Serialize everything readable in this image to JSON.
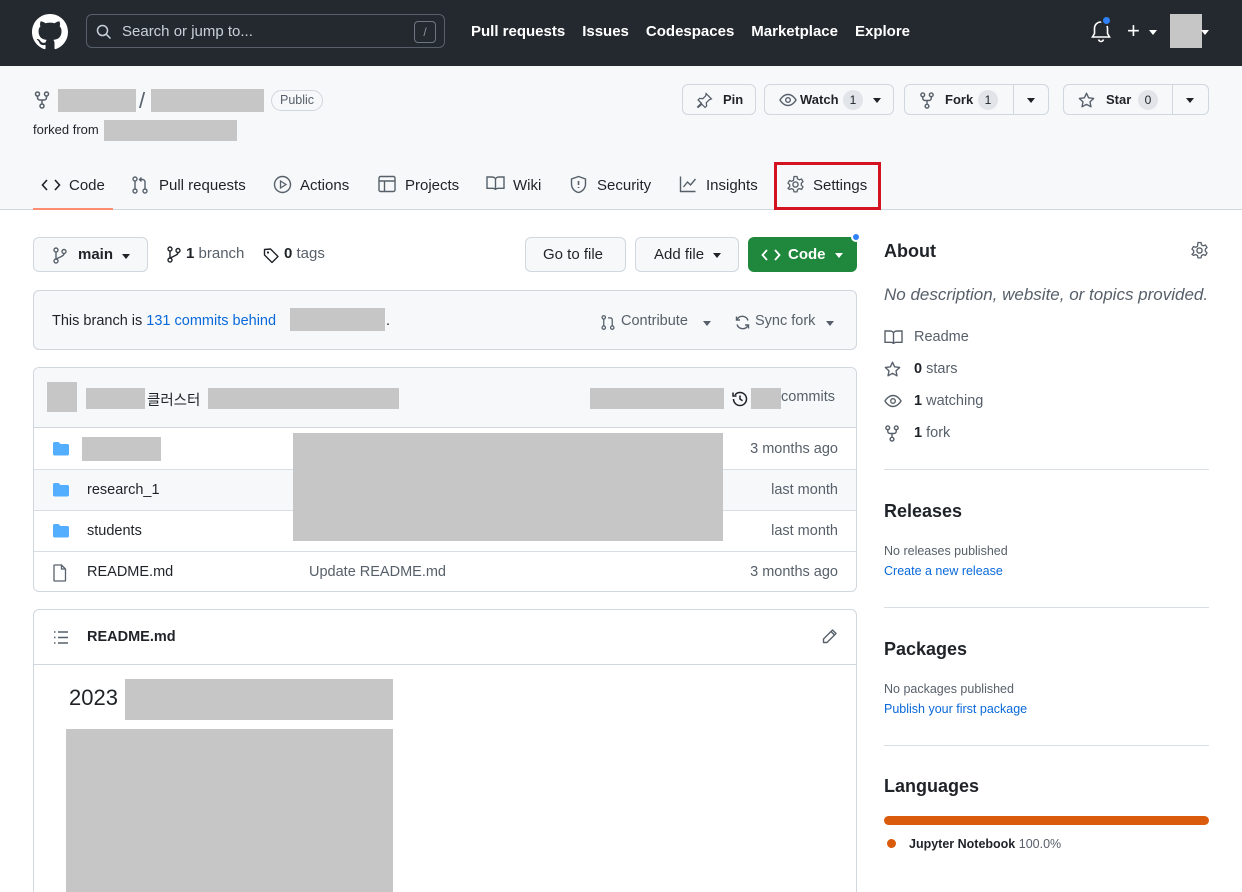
{
  "header": {
    "search_placeholder": "Search or jump to...",
    "search_shortcut": "/",
    "nav": [
      "Pull requests",
      "Issues",
      "Codespaces",
      "Marketplace",
      "Explore"
    ],
    "plus_label": "+"
  },
  "repo": {
    "separator": "/",
    "visibility": "Public",
    "forked_from_label": "forked from",
    "pin_label": "Pin",
    "watch_label": "Watch",
    "watch_count": "1",
    "fork_label": "Fork",
    "fork_count": "1",
    "star_label": "Star",
    "star_count": "0"
  },
  "tabs": [
    {
      "label": "Code",
      "icon": "code-icon",
      "active": true
    },
    {
      "label": "Pull requests",
      "icon": "pull-request-icon"
    },
    {
      "label": "Actions",
      "icon": "play-icon"
    },
    {
      "label": "Projects",
      "icon": "table-icon"
    },
    {
      "label": "Wiki",
      "icon": "book-icon"
    },
    {
      "label": "Security",
      "icon": "shield-icon"
    },
    {
      "label": "Insights",
      "icon": "graph-icon"
    },
    {
      "label": "Settings",
      "icon": "gear-icon",
      "highlighted": true
    }
  ],
  "branchbar": {
    "branch": "main",
    "branch_count": "1",
    "branch_word": "branch",
    "tag_count": "0",
    "tag_word": "tags",
    "go_to_file": "Go to file",
    "add_file": "Add file",
    "code_button": "Code"
  },
  "behind": {
    "prefix": "This branch is",
    "link": "131 commits behind",
    "suffix": ".",
    "contribute": "Contribute",
    "sync": "Sync fork"
  },
  "commit": {
    "message_fragment": "클러스터",
    "commits_word": "commits"
  },
  "files": [
    {
      "name": "",
      "type": "folder",
      "message": "",
      "age": "3 months ago",
      "redacted": true
    },
    {
      "name": "research_1",
      "type": "folder",
      "message": "",
      "age": "last month"
    },
    {
      "name": "students",
      "type": "folder",
      "message": "",
      "age": "last month"
    },
    {
      "name": "README.md",
      "type": "file",
      "message": "Update README.md",
      "age": "3 months ago"
    }
  ],
  "readme": {
    "title": "README.md",
    "heading_year": "2023"
  },
  "sidebar": {
    "about_title": "About",
    "about_desc": "No description, website, or topics provided.",
    "readme": "Readme",
    "stars_count": "0",
    "stars_word": "stars",
    "watching_count": "1",
    "watching_word": "watching",
    "fork_count": "1",
    "fork_word": "fork",
    "releases_title": "Releases",
    "releases_none": "No releases published",
    "releases_link": "Create a new release",
    "packages_title": "Packages",
    "packages_none": "No packages published",
    "packages_link": "Publish your first package",
    "languages_title": "Languages",
    "language_name": "Jupyter Notebook",
    "language_pct": "100.0%",
    "language_color": "#DA5B0B"
  },
  "colors": {
    "header_bg": "#24292f",
    "accent_green": "#1f883d",
    "link_blue": "#0969da",
    "highlight_red": "#d3131f"
  }
}
